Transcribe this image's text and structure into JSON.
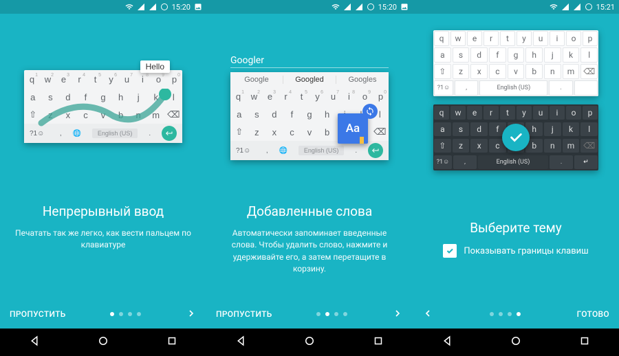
{
  "status": {
    "time": "15:20",
    "time3": "15:21"
  },
  "keys": {
    "row1": [
      "q",
      "w",
      "e",
      "r",
      "t",
      "y",
      "u",
      "i",
      "o",
      "p"
    ],
    "nums": [
      "1",
      "2",
      "3",
      "4",
      "5",
      "6",
      "7",
      "8",
      "9",
      "0"
    ],
    "row2": [
      "a",
      "s",
      "d",
      "f",
      "g",
      "h",
      "j",
      "k",
      "l"
    ],
    "row3": [
      "z",
      "x",
      "c",
      "v",
      "b",
      "n",
      "m"
    ],
    "sym": "?1☺",
    "lang": "English (US)"
  },
  "panel1": {
    "tooltip": "Hello",
    "title": "Непрерывный ввод",
    "desc": "Печатать так же легко, как вести пальцем по клавиатуре",
    "skip": "ПРОПУСТИТЬ"
  },
  "panel2": {
    "typed": "Googler",
    "s1": "Google",
    "s2": "Googled",
    "s3": "Googles",
    "dict_aa": "Aa",
    "title": "Добавленные слова",
    "desc": "Автоматически запоминает введенные слова. Чтобы удалить слово, нажмите и удерживайте его, а затем перетащите в корзину.",
    "skip": "ПРОПУСТИТЬ"
  },
  "panel3": {
    "title": "Выберите тему",
    "cb_label": "Показывать границы клавиш",
    "done": "ГОТОВО"
  }
}
